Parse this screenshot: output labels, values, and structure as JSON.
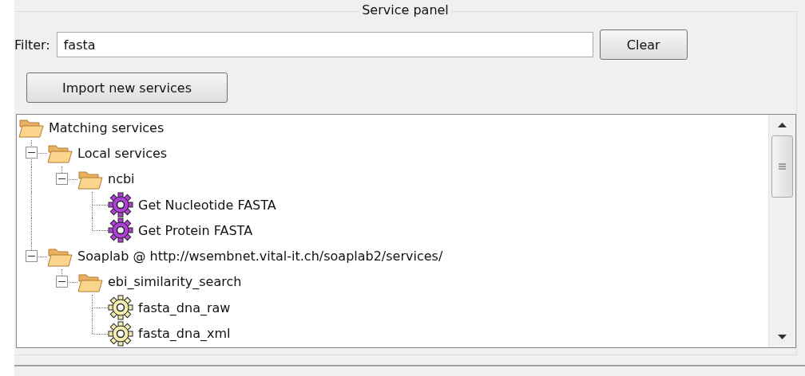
{
  "panel": {
    "title": "Service panel"
  },
  "filter": {
    "label": "Filter:",
    "value": "fasta"
  },
  "buttons": {
    "clear": "Clear",
    "import": "Import new services"
  },
  "tree": [
    {
      "label": "Matching services",
      "kind": "folder",
      "children": [
        {
          "label": "Local services",
          "kind": "folder",
          "expanded": true,
          "children": [
            {
              "label": "ncbi",
              "kind": "folder",
              "expanded": true,
              "children": [
                {
                  "label": "Get Nucleotide FASTA",
                  "kind": "service",
                  "color": "#b040d8"
                },
                {
                  "label": "Get Protein FASTA",
                  "kind": "service",
                  "color": "#b040d8"
                }
              ]
            }
          ]
        },
        {
          "label": "Soaplab @ http://wsembnet.vital-it.ch/soaplab2/services/",
          "kind": "folder",
          "expanded": true,
          "children": [
            {
              "label": "ebi_similarity_search",
              "kind": "folder",
              "expanded": true,
              "children": [
                {
                  "label": "fasta_dna_raw",
                  "kind": "service",
                  "color": "#f4eeb0"
                },
                {
                  "label": "fasta_dna_xml",
                  "kind": "service",
                  "color": "#f4eeb0"
                }
              ]
            }
          ]
        }
      ]
    }
  ]
}
